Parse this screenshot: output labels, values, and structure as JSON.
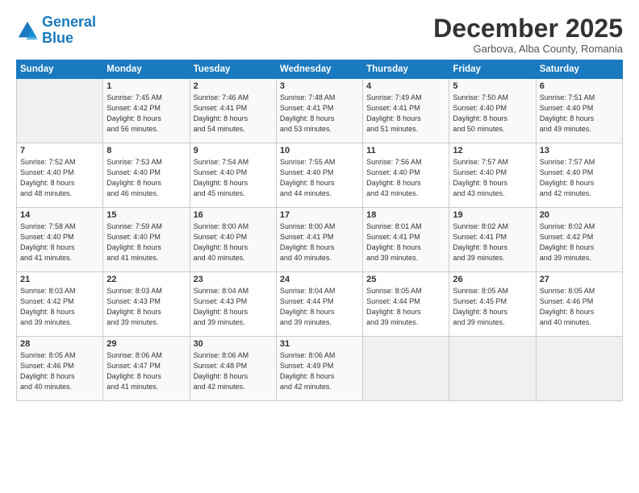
{
  "header": {
    "logo_line1": "General",
    "logo_line2": "Blue",
    "month_title": "December 2025",
    "location": "Garbova, Alba County, Romania"
  },
  "days_of_week": [
    "Sunday",
    "Monday",
    "Tuesday",
    "Wednesday",
    "Thursday",
    "Friday",
    "Saturday"
  ],
  "weeks": [
    [
      {
        "day": "",
        "info": ""
      },
      {
        "day": "1",
        "info": "Sunrise: 7:45 AM\nSunset: 4:42 PM\nDaylight: 8 hours\nand 56 minutes."
      },
      {
        "day": "2",
        "info": "Sunrise: 7:46 AM\nSunset: 4:41 PM\nDaylight: 8 hours\nand 54 minutes."
      },
      {
        "day": "3",
        "info": "Sunrise: 7:48 AM\nSunset: 4:41 PM\nDaylight: 8 hours\nand 53 minutes."
      },
      {
        "day": "4",
        "info": "Sunrise: 7:49 AM\nSunset: 4:41 PM\nDaylight: 8 hours\nand 51 minutes."
      },
      {
        "day": "5",
        "info": "Sunrise: 7:50 AM\nSunset: 4:40 PM\nDaylight: 8 hours\nand 50 minutes."
      },
      {
        "day": "6",
        "info": "Sunrise: 7:51 AM\nSunset: 4:40 PM\nDaylight: 8 hours\nand 49 minutes."
      }
    ],
    [
      {
        "day": "7",
        "info": "Sunrise: 7:52 AM\nSunset: 4:40 PM\nDaylight: 8 hours\nand 48 minutes."
      },
      {
        "day": "8",
        "info": "Sunrise: 7:53 AM\nSunset: 4:40 PM\nDaylight: 8 hours\nand 46 minutes."
      },
      {
        "day": "9",
        "info": "Sunrise: 7:54 AM\nSunset: 4:40 PM\nDaylight: 8 hours\nand 45 minutes."
      },
      {
        "day": "10",
        "info": "Sunrise: 7:55 AM\nSunset: 4:40 PM\nDaylight: 8 hours\nand 44 minutes."
      },
      {
        "day": "11",
        "info": "Sunrise: 7:56 AM\nSunset: 4:40 PM\nDaylight: 8 hours\nand 43 minutes."
      },
      {
        "day": "12",
        "info": "Sunrise: 7:57 AM\nSunset: 4:40 PM\nDaylight: 8 hours\nand 43 minutes."
      },
      {
        "day": "13",
        "info": "Sunrise: 7:57 AM\nSunset: 4:40 PM\nDaylight: 8 hours\nand 42 minutes."
      }
    ],
    [
      {
        "day": "14",
        "info": "Sunrise: 7:58 AM\nSunset: 4:40 PM\nDaylight: 8 hours\nand 41 minutes."
      },
      {
        "day": "15",
        "info": "Sunrise: 7:59 AM\nSunset: 4:40 PM\nDaylight: 8 hours\nand 41 minutes."
      },
      {
        "day": "16",
        "info": "Sunrise: 8:00 AM\nSunset: 4:40 PM\nDaylight: 8 hours\nand 40 minutes."
      },
      {
        "day": "17",
        "info": "Sunrise: 8:00 AM\nSunset: 4:41 PM\nDaylight: 8 hours\nand 40 minutes."
      },
      {
        "day": "18",
        "info": "Sunrise: 8:01 AM\nSunset: 4:41 PM\nDaylight: 8 hours\nand 39 minutes."
      },
      {
        "day": "19",
        "info": "Sunrise: 8:02 AM\nSunset: 4:41 PM\nDaylight: 8 hours\nand 39 minutes."
      },
      {
        "day": "20",
        "info": "Sunrise: 8:02 AM\nSunset: 4:42 PM\nDaylight: 8 hours\nand 39 minutes."
      }
    ],
    [
      {
        "day": "21",
        "info": "Sunrise: 8:03 AM\nSunset: 4:42 PM\nDaylight: 8 hours\nand 39 minutes."
      },
      {
        "day": "22",
        "info": "Sunrise: 8:03 AM\nSunset: 4:43 PM\nDaylight: 8 hours\nand 39 minutes."
      },
      {
        "day": "23",
        "info": "Sunrise: 8:04 AM\nSunset: 4:43 PM\nDaylight: 8 hours\nand 39 minutes."
      },
      {
        "day": "24",
        "info": "Sunrise: 8:04 AM\nSunset: 4:44 PM\nDaylight: 8 hours\nand 39 minutes."
      },
      {
        "day": "25",
        "info": "Sunrise: 8:05 AM\nSunset: 4:44 PM\nDaylight: 8 hours\nand 39 minutes."
      },
      {
        "day": "26",
        "info": "Sunrise: 8:05 AM\nSunset: 4:45 PM\nDaylight: 8 hours\nand 39 minutes."
      },
      {
        "day": "27",
        "info": "Sunrise: 8:05 AM\nSunset: 4:46 PM\nDaylight: 8 hours\nand 40 minutes."
      }
    ],
    [
      {
        "day": "28",
        "info": "Sunrise: 8:05 AM\nSunset: 4:46 PM\nDaylight: 8 hours\nand 40 minutes."
      },
      {
        "day": "29",
        "info": "Sunrise: 8:06 AM\nSunset: 4:47 PM\nDaylight: 8 hours\nand 41 minutes."
      },
      {
        "day": "30",
        "info": "Sunrise: 8:06 AM\nSunset: 4:48 PM\nDaylight: 8 hours\nand 42 minutes."
      },
      {
        "day": "31",
        "info": "Sunrise: 8:06 AM\nSunset: 4:49 PM\nDaylight: 8 hours\nand 42 minutes."
      },
      {
        "day": "",
        "info": ""
      },
      {
        "day": "",
        "info": ""
      },
      {
        "day": "",
        "info": ""
      }
    ]
  ]
}
